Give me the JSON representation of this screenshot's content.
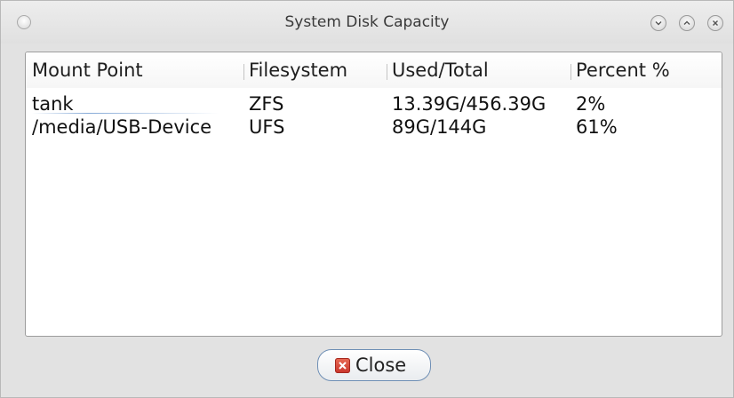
{
  "window": {
    "title": "System Disk Capacity",
    "controls": {
      "menu_icon": "window-menu-icon",
      "minimize_icon": "chevron-down-icon",
      "maximize_icon": "chevron-up-icon",
      "close_icon": "x-icon"
    }
  },
  "table": {
    "columns": [
      "Mount Point",
      "Filesystem",
      "Used/Total",
      "Percent %"
    ],
    "rows": [
      {
        "mount": "tank",
        "fs": "ZFS",
        "used_total": "13.39G/456.39G",
        "percent": "2%"
      },
      {
        "mount": "/media/USB-Device",
        "fs": "UFS",
        "used_total": "89G/144G",
        "percent": "61%"
      }
    ]
  },
  "footer": {
    "close_label": "Close",
    "close_icon": "close-x-icon",
    "accent": "#d0372d"
  }
}
